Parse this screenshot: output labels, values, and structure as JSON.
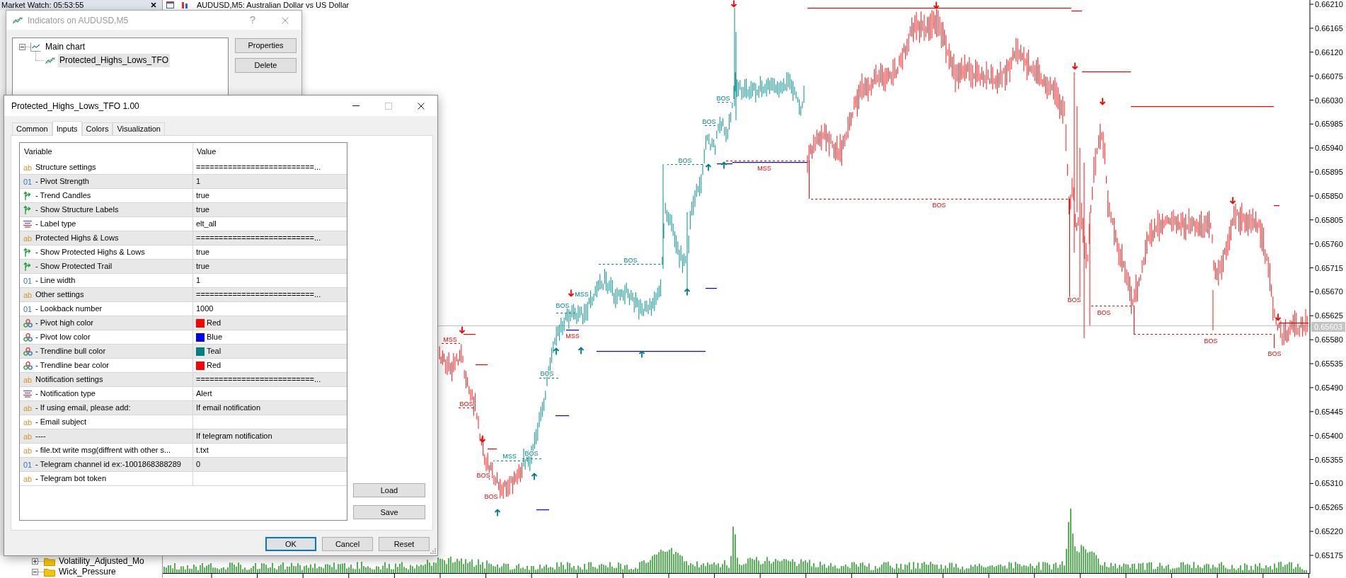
{
  "market_watch": {
    "title": "Market Watch: 05:53:55"
  },
  "chart": {
    "title": "AUDUSD,M5: Australian Dollar vs US Dollar",
    "price_axis": [
      "0.66210",
      "0.66165",
      "0.66120",
      "0.66075",
      "0.66030",
      "0.65985",
      "0.65940",
      "0.65895",
      "0.65850",
      "0.65805",
      "0.65760",
      "0.65715",
      "0.65670",
      "0.65625",
      "0.65580",
      "0.65535",
      "0.65490",
      "0.65445",
      "0.65400",
      "0.65355",
      "0.65310",
      "0.65265",
      "0.65220",
      "0.65175"
    ],
    "current_price": "0.65603",
    "labels": [
      {
        "text": "MSS",
        "kind": "bearish"
      },
      {
        "text": "BOS",
        "kind": "bearish"
      },
      {
        "text": "BOS",
        "kind": "bearish"
      },
      {
        "text": "BOS",
        "kind": "bearish"
      },
      {
        "text": "MSS",
        "kind": "bullish"
      },
      {
        "text": "BOS",
        "kind": "bullish"
      },
      {
        "text": "BOS",
        "kind": "bullish"
      },
      {
        "text": "BOS",
        "kind": "bullish"
      },
      {
        "text": "MSS",
        "kind": "bearish"
      },
      {
        "text": "MSS",
        "kind": "bullish"
      },
      {
        "text": "BOS",
        "kind": "bullish"
      },
      {
        "text": "BOS",
        "kind": "bullish"
      },
      {
        "text": "BOS",
        "kind": "bullish"
      },
      {
        "text": "BOS",
        "kind": "bullish"
      },
      {
        "text": "MSS",
        "kind": "bearish"
      },
      {
        "text": "BOS",
        "kind": "bearish"
      },
      {
        "text": "BOS",
        "kind": "bearish"
      },
      {
        "text": "BOS",
        "kind": "bearish"
      },
      {
        "text": "BOS",
        "kind": "bearish"
      },
      {
        "text": "BOS",
        "kind": "bearish"
      }
    ]
  },
  "navigator": {
    "items": [
      {
        "label": "Volatility_Adjusted_Mo",
        "expanded": false
      },
      {
        "label": "Wick_Pressure",
        "expanded": true
      }
    ]
  },
  "indicators_dialog": {
    "title": "Indicators on AUDUSD,M5",
    "active": false,
    "help": "?",
    "tree": [
      {
        "label": "Main chart",
        "expanded": true,
        "children": [
          {
            "label": "Protected_Highs_Lows_TFO",
            "selected": true
          }
        ]
      }
    ],
    "buttons": [
      "Properties",
      "Delete"
    ]
  },
  "properties_dialog": {
    "title": "Protected_Highs_Lows_TFO 1.00",
    "active": true,
    "window_controls": [
      {
        "kind": "minimize",
        "disabled": false
      },
      {
        "kind": "maximize",
        "disabled": true
      },
      {
        "kind": "close",
        "disabled": false
      }
    ],
    "tabs": [
      {
        "label": "Common",
        "selected": false
      },
      {
        "label": "Inputs",
        "selected": true
      },
      {
        "label": "Colors",
        "selected": false
      },
      {
        "label": "Visualization",
        "selected": false
      }
    ],
    "columns": [
      "Variable",
      "Value"
    ],
    "rows": [
      {
        "kind": "text",
        "glyph": "ab",
        "variable": "Structure settings",
        "value": "==========================..."
      },
      {
        "kind": "number",
        "glyph": "01",
        "variable": "- Pivot Strength",
        "value": "1"
      },
      {
        "kind": "bool",
        "variable": "- Trend Candles",
        "value": "true"
      },
      {
        "kind": "bool",
        "variable": "- Show Structure Labels",
        "value": "true"
      },
      {
        "kind": "enum",
        "variable": "- Label type",
        "value": "elt_all"
      },
      {
        "kind": "text",
        "glyph": "ab",
        "variable": "Protected Highs & Lows",
        "value": "==========================..."
      },
      {
        "kind": "bool",
        "variable": "- Show Protected Highs & Lows",
        "value": "true"
      },
      {
        "kind": "bool",
        "variable": "- Show Protected Trail",
        "value": "true"
      },
      {
        "kind": "number",
        "glyph": "01",
        "variable": "- Line width",
        "value": "1"
      },
      {
        "kind": "text",
        "glyph": "ab",
        "variable": "Other settings",
        "value": "==========================..."
      },
      {
        "kind": "number",
        "glyph": "01",
        "variable": "- Lookback number",
        "value": "1000"
      },
      {
        "kind": "color",
        "variable": "- Pivot high color",
        "color": "#ff0000",
        "value": "Red"
      },
      {
        "kind": "color",
        "variable": "- Pivot low color",
        "color": "#0000ff",
        "value": "Blue"
      },
      {
        "kind": "color",
        "variable": "- Trendline bull color",
        "color": "#008080",
        "value": "Teal"
      },
      {
        "kind": "color",
        "variable": "- Trendline bear color",
        "color": "#ff0000",
        "value": "Red"
      },
      {
        "kind": "text",
        "glyph": "ab",
        "variable": "Notification settings",
        "value": "==========================..."
      },
      {
        "kind": "enum",
        "variable": "- Notification type",
        "value": "Alert"
      },
      {
        "kind": "text",
        "glyph": "ab",
        "variable": "- If using email, please add:",
        "value": "If email notification"
      },
      {
        "kind": "text",
        "glyph": "ab",
        "variable": "- Email subject"
      },
      {
        "kind": "text",
        "glyph": "ab",
        "variable": "----",
        "value": "If telegram notification"
      },
      {
        "kind": "text",
        "glyph": "ab",
        "variable": "- file.txt write msg(diffrent with other s...",
        "value": "t.txt"
      },
      {
        "kind": "number",
        "glyph": "01",
        "variable": "- Telegram channel id ex:-1001868388289",
        "value": "0"
      },
      {
        "kind": "text",
        "glyph": "ab",
        "variable": "- Telegram bot token"
      }
    ],
    "side_buttons": [
      "Load",
      "Save"
    ],
    "buttons": [
      {
        "label": "OK",
        "default": true
      },
      {
        "label": "Cancel",
        "default": false
      },
      {
        "label": "Reset",
        "default": false
      }
    ]
  }
}
